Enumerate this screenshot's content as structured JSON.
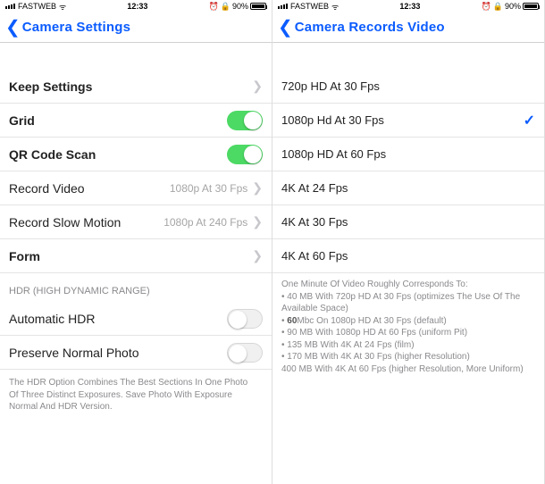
{
  "left": {
    "status": {
      "carrier": "FASTWEB",
      "time": "12:33",
      "battery": "90%"
    },
    "navtitle": "Camera Settings",
    "rows": {
      "keep": "Keep Settings",
      "grid": "Grid",
      "qr": "QR Code Scan",
      "record_video_label": "Record Video",
      "record_video_value": "1080p At 30 Fps",
      "record_slow_label": "Record Slow Motion",
      "record_slow_value": "1080p At 240 Fps",
      "form": "Form"
    },
    "hdr": {
      "header": "HDR (HIGH DYNAMIC RANGE)",
      "auto": "Automatic HDR",
      "preserve": "Preserve Normal Photo",
      "footer_l1": "The HDR Option Combines The Best Sections In One Photo",
      "footer_l2": "Of Three Distinct Exposures. Save Photo With Exposure",
      "footer_l3": "Normal And HDR Version."
    }
  },
  "right": {
    "status": {
      "carrier": "FASTWEB",
      "time": "12:33",
      "battery": "90%"
    },
    "navtitle": "Camera Records Video",
    "options": {
      "opt1": "720p HD At 30 Fps",
      "opt2": "1080p Hd At 30 Fps",
      "opt3": "1080p HD At 60 Fps",
      "opt4": "4K At 24 Fps",
      "opt5": "4K At 30 Fps",
      "opt6": "4K At 60 Fps"
    },
    "info": {
      "line1": "One Minute Of Video Roughly Corresponds To:",
      "line2": "• 40 MB With 720p HD At 30 Fps (optimizes The Use Of The Available Space)",
      "line3_pre": "• ",
      "line3_num": "60",
      "line3_post": "Mbc On 1080p HD At 30 Fps (default)",
      "line4": "• 90 MB With 1080p HD At 60 Fps (uniform Pit)",
      "line5": "• 135 MB With 4K At 24 Fps (film)",
      "line6": "• 170 MB With 4K At 30 Fps (higher Resolution)",
      "line7": "400 MB With 4K At 60 Fps (higher Resolution, More Uniform)"
    }
  }
}
